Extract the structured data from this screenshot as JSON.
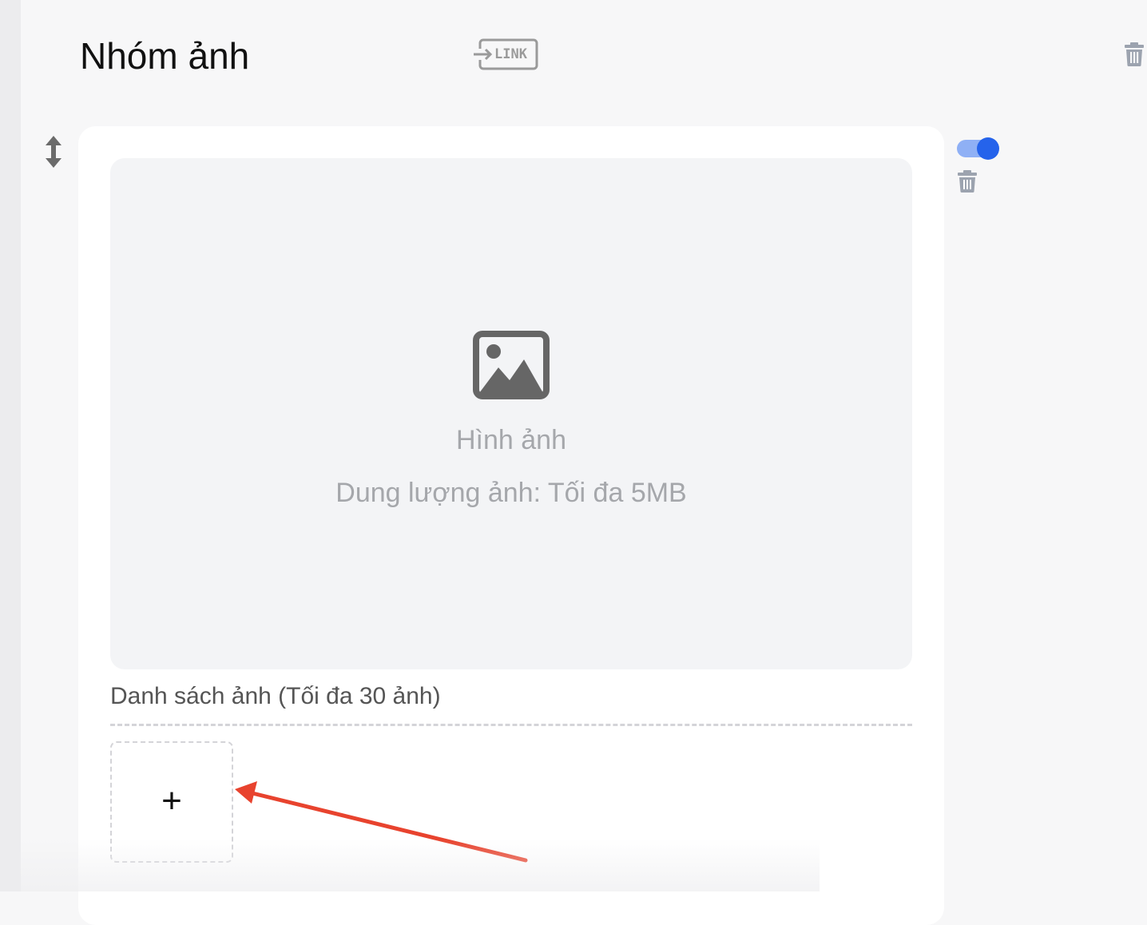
{
  "section": {
    "title": "Nhóm ảnh",
    "link_button_label": "LINK"
  },
  "image_block": {
    "dropzone_title": "Hình ảnh",
    "dropzone_hint": "Dung lượng ảnh: Tối đa 5MB",
    "list_title": "Danh sách ảnh (Tối đa 30 ảnh)",
    "add_button_symbol": "+",
    "enabled": true
  },
  "icons": {
    "link": "link-icon",
    "section_delete": "trash-icon",
    "drag": "drag-vertical-icon",
    "image": "image-icon",
    "toggle": "toggle-switch",
    "block_delete": "trash-icon",
    "add": "plus-icon",
    "annotation": "arrow-icon"
  },
  "colors": {
    "accent": "#2563eb",
    "accent_light": "#8fb0f5",
    "annotation": "#e8432e",
    "icon_gray": "#9ca3af",
    "page_background": "#f7f7f8"
  }
}
